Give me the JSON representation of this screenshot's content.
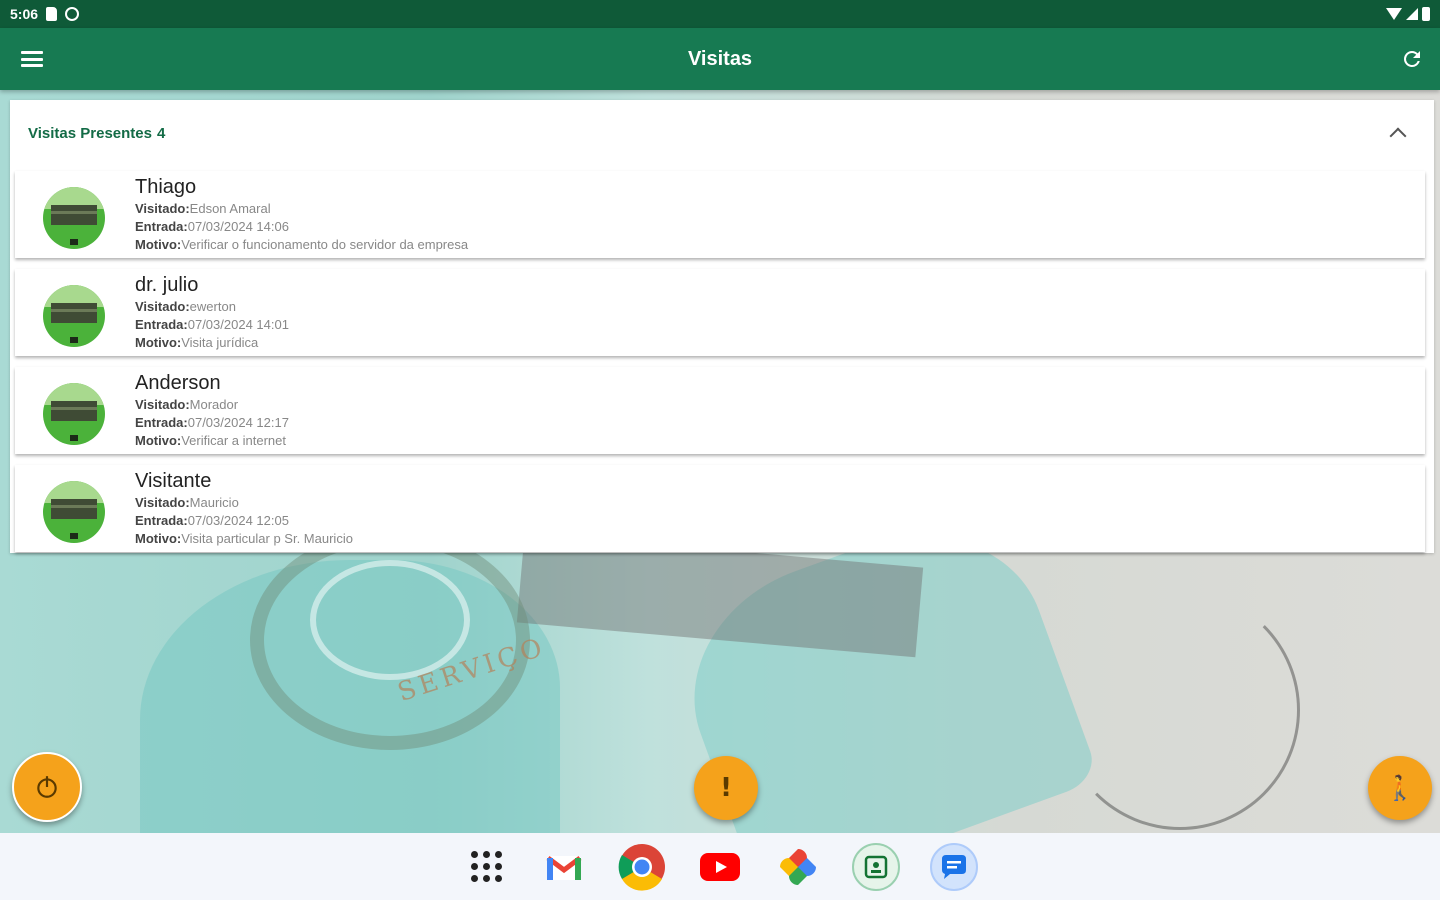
{
  "status_bar": {
    "time": "5:06"
  },
  "app_bar": {
    "title": "Visitas",
    "menu_icon": "menu-icon",
    "refresh_icon": "refresh-icon",
    "color": "#177a52"
  },
  "panel": {
    "title": "Visitas Presentes",
    "count": "4",
    "accent": "#136b46"
  },
  "labels": {
    "visited": "Visitado:",
    "entry": "Entrada:",
    "reason": "Motivo:"
  },
  "visits": [
    {
      "name": "Thiago",
      "visited": "Edson Amaral",
      "entry": "07/03/2024 14:06",
      "reason": "Verificar o funcionamento do servidor da empresa"
    },
    {
      "name": "dr. julio",
      "visited": "ewerton",
      "entry": "07/03/2024 14:01",
      "reason": "Visita jurídica"
    },
    {
      "name": "Anderson",
      "visited": "Morador",
      "entry": "07/03/2024 12:17",
      "reason": "Verificar a internet"
    },
    {
      "name": "Visitante",
      "visited": "Mauricio",
      "entry": "07/03/2024 12:05",
      "reason": "Visita particular p Sr. Mauricio"
    }
  ],
  "background": {
    "patch_text": "SERVIÇO"
  },
  "fabs": {
    "power_icon": "power-icon",
    "alert_glyph": "!",
    "walk_glyph": "🚶",
    "color": "#f5a21b"
  },
  "dock": [
    "apps-grid-icon",
    "gmail-icon",
    "chrome-icon",
    "youtube-icon",
    "photos-icon",
    "meet-icon",
    "messages-icon"
  ]
}
